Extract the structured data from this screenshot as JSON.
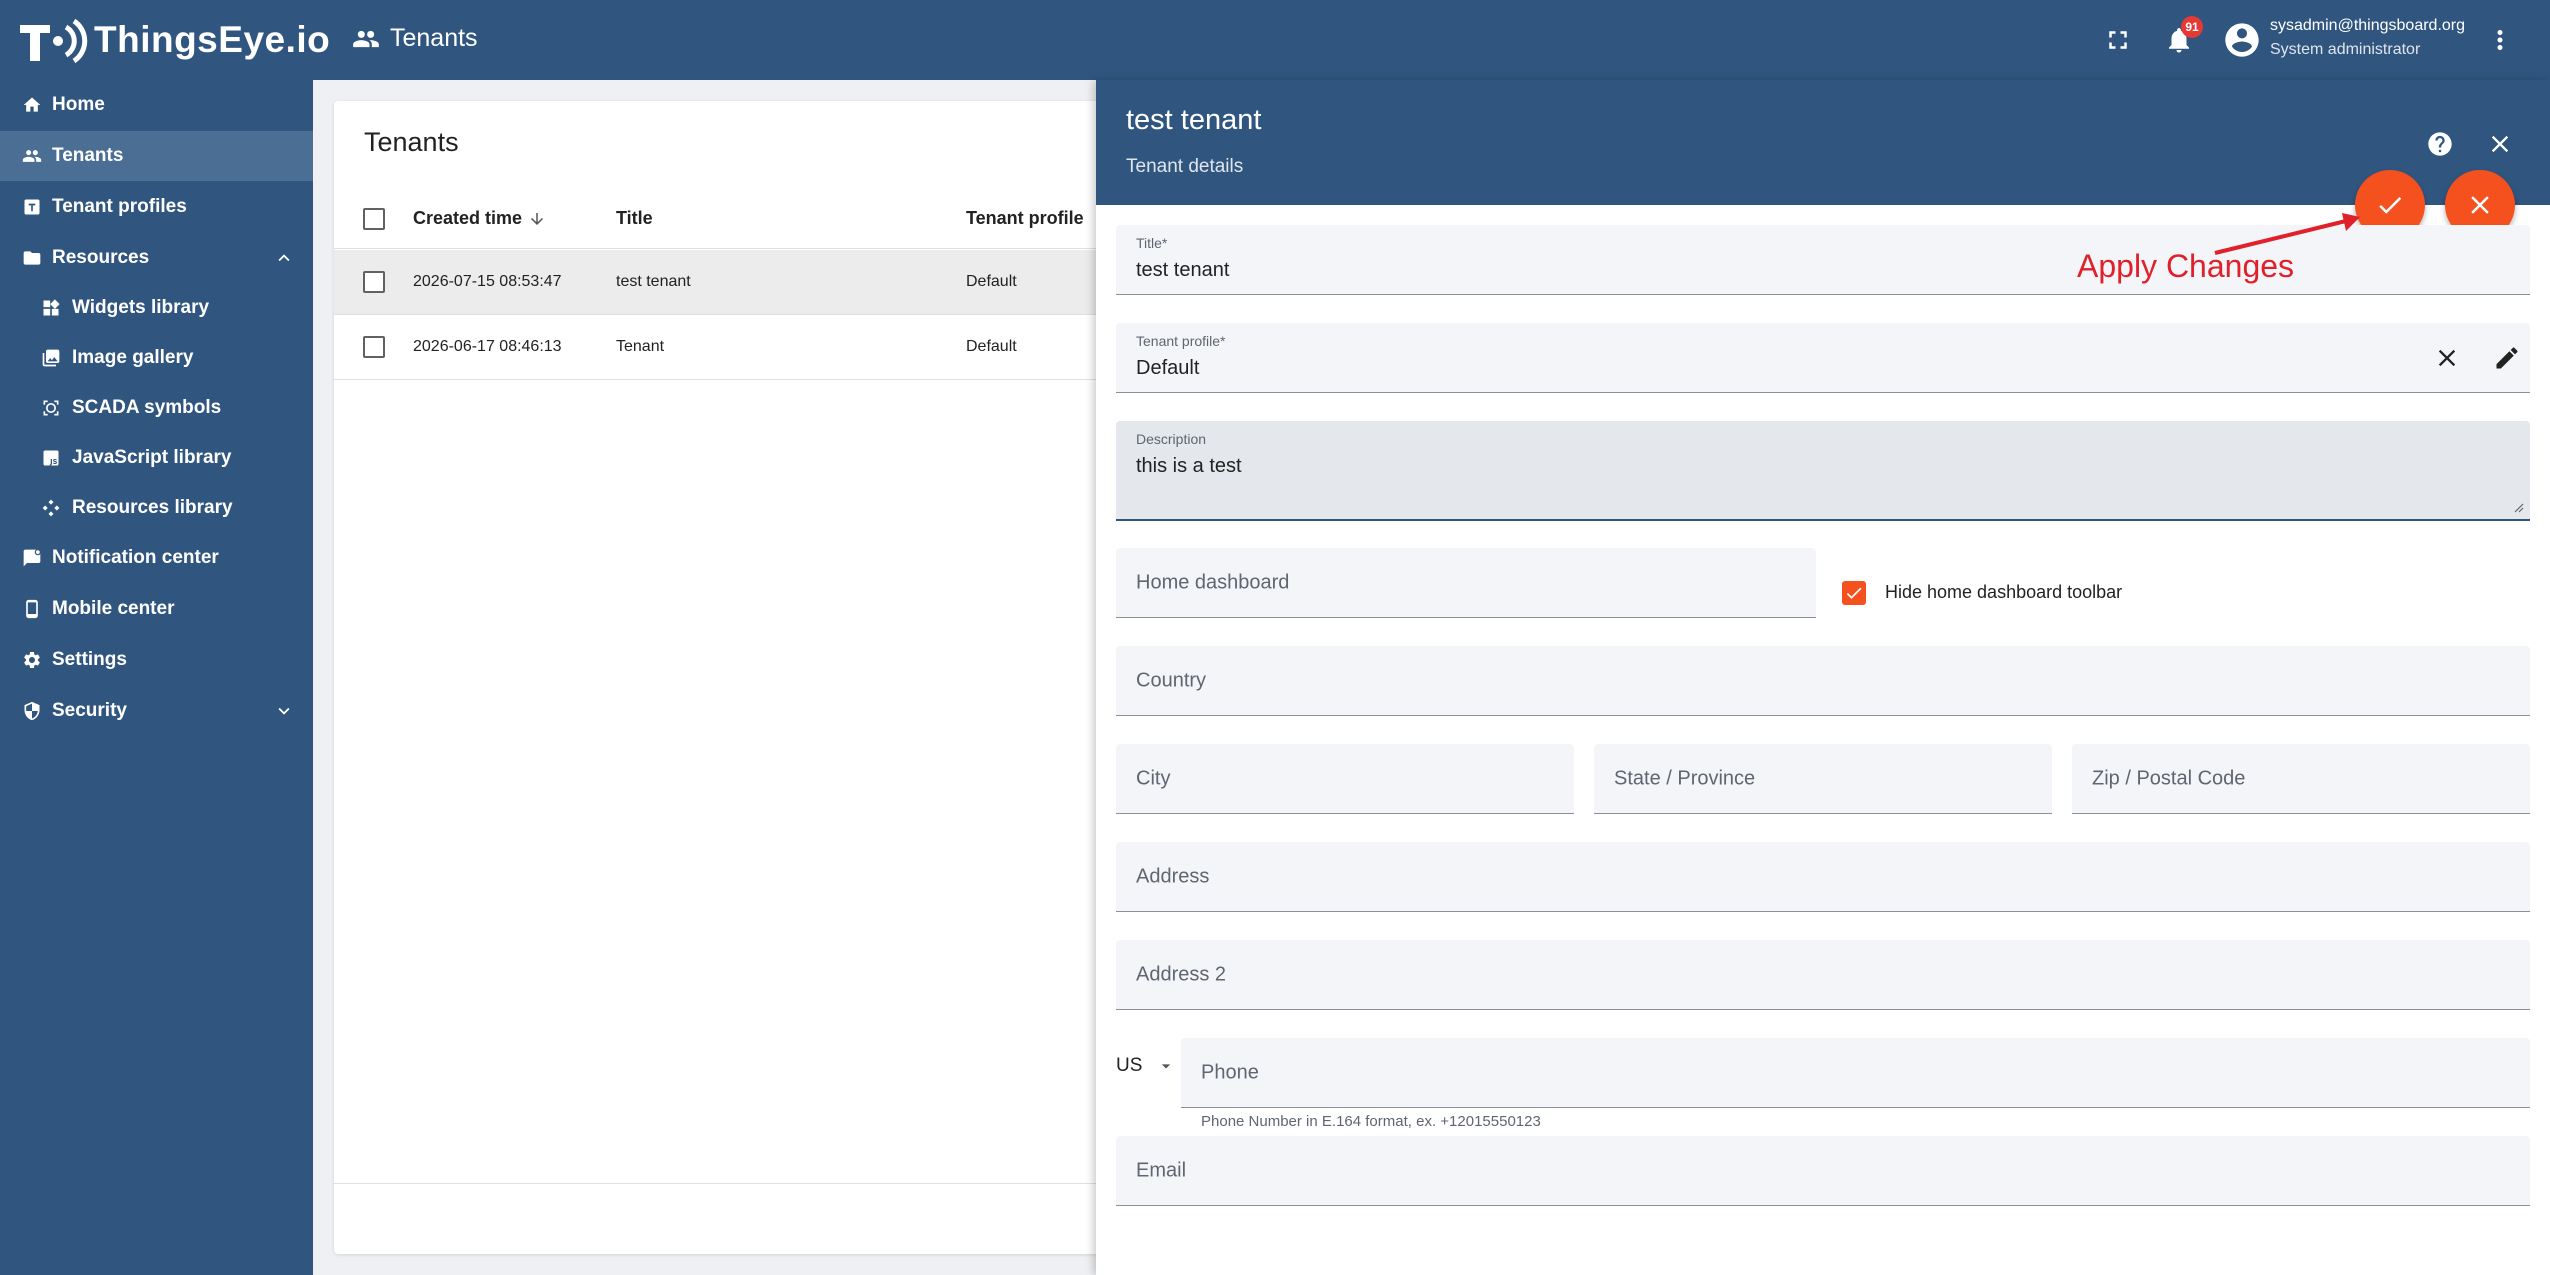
{
  "app": {
    "logo_text": "ThingsEye.io",
    "page_title": "Tenants"
  },
  "topbar": {
    "notification_count": "91",
    "user_email": "sysadmin@thingsboard.org",
    "user_role": "System administrator"
  },
  "sidebar": {
    "items": [
      {
        "label": "Home",
        "icon": "home-icon"
      },
      {
        "label": "Tenants",
        "icon": "people-icon",
        "active": true
      },
      {
        "label": "Tenant profiles",
        "icon": "tenant-profile-icon"
      },
      {
        "label": "Resources",
        "icon": "folder-icon",
        "expanded": true
      },
      {
        "label": "Widgets library",
        "icon": "widgets-icon"
      },
      {
        "label": "Image gallery",
        "icon": "image-icon"
      },
      {
        "label": "SCADA symbols",
        "icon": "scada-icon"
      },
      {
        "label": "JavaScript library",
        "icon": "javascript-icon"
      },
      {
        "label": "Resources library",
        "icon": "resources-icon"
      },
      {
        "label": "Notification center",
        "icon": "notification-icon"
      },
      {
        "label": "Mobile center",
        "icon": "mobile-icon"
      },
      {
        "label": "Settings",
        "icon": "gear-icon"
      },
      {
        "label": "Security",
        "icon": "shield-icon",
        "expanded": false
      }
    ]
  },
  "list": {
    "title": "Tenants",
    "columns": [
      "Created time",
      "Title",
      "Tenant profile"
    ],
    "rows": [
      {
        "created": "2026-07-15 08:53:47",
        "title": "test tenant",
        "profile": "Default"
      },
      {
        "created": "2026-06-17 08:46:13",
        "title": "Tenant",
        "profile": "Default"
      }
    ]
  },
  "details": {
    "title": "test tenant",
    "subtitle": "Tenant details",
    "fields": {
      "title_label": "Title*",
      "title_value": "test tenant",
      "profile_label": "Tenant profile*",
      "profile_value": "Default",
      "description_label": "Description",
      "description_value": "this is a test",
      "home_dashboard_ph": "Home dashboard",
      "hide_toolbar_label": "Hide home dashboard toolbar",
      "hide_toolbar_checked": true,
      "country_ph": "Country",
      "city_ph": "City",
      "state_ph": "State / Province",
      "zip_ph": "Zip / Postal Code",
      "address_ph": "Address",
      "address2_ph": "Address 2",
      "phone_country": "US",
      "phone_ph": "Phone",
      "phone_hint": "Phone Number in E.164 format, ex. +12015550123",
      "email_ph": "Email"
    }
  },
  "annotation": {
    "text": "Apply Changes",
    "color": "#e0202a"
  },
  "colors": {
    "primary": "#305680",
    "accent": "#f4511e"
  }
}
